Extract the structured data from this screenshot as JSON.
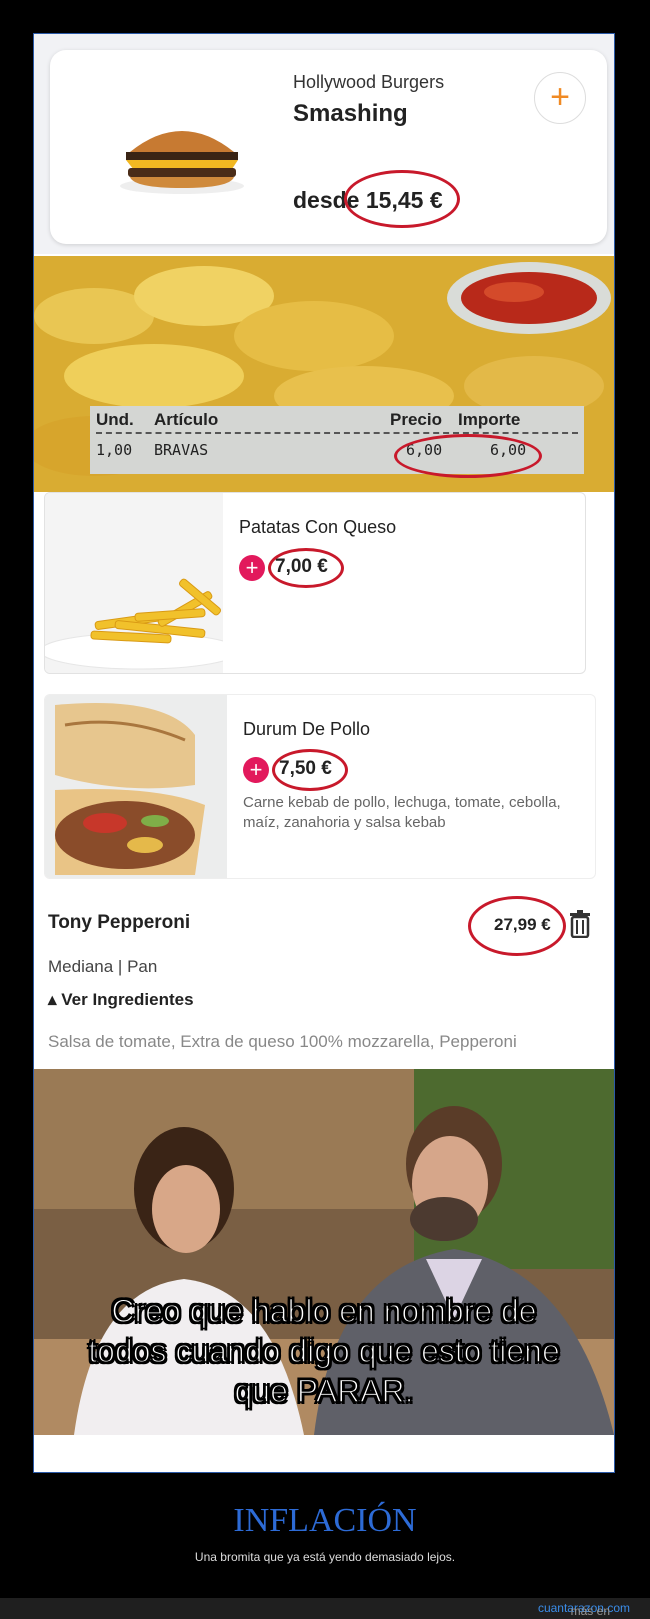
{
  "burger_card": {
    "restaurant": "Hollywood Burgers",
    "dish": "Smashing",
    "price_prefix": "desde ",
    "price": "15,45 €"
  },
  "receipt": {
    "col_und": "Und.",
    "col_articulo": "Artículo",
    "col_precio": "Precio",
    "col_importe": "Importe",
    "qty": "1,00",
    "item": "BRAVAS",
    "precio": "6,00",
    "importe": "6,00"
  },
  "patatas_card": {
    "title": "Patatas Con Queso",
    "price": "7,00 €"
  },
  "durum_card": {
    "title": "Durum De Pollo",
    "price": "7,50 €",
    "description": "Carne kebab de pollo, lechuga, tomate, cebolla, maíz, zanahoria y salsa kebab"
  },
  "pizza_item": {
    "name": "Tony Pepperoni",
    "price": "27,99 €",
    "size": "Mediana | Pan",
    "ingredients_toggle": "▴ Ver Ingredientes",
    "ingredients": "Salsa de tomate, Extra de queso 100% mozzarella, Pepperoni"
  },
  "meme": {
    "subtitle_line1": "Creo que hablo en nombre de",
    "subtitle_line2": "todos cuando digo que esto tiene",
    "subtitle_line3": "que PARAR."
  },
  "footer": {
    "title": "INFLACIÓN",
    "subtitle": "Una bromita que ya está yendo demasiado lejos.",
    "more_prefix": "más en ",
    "site": "cuantarazon.com"
  },
  "colors": {
    "annotation_red": "#c8192b",
    "plus_orange": "#f08a24",
    "plus_pink": "#e2195c",
    "title_blue": "#2d6bd6"
  }
}
